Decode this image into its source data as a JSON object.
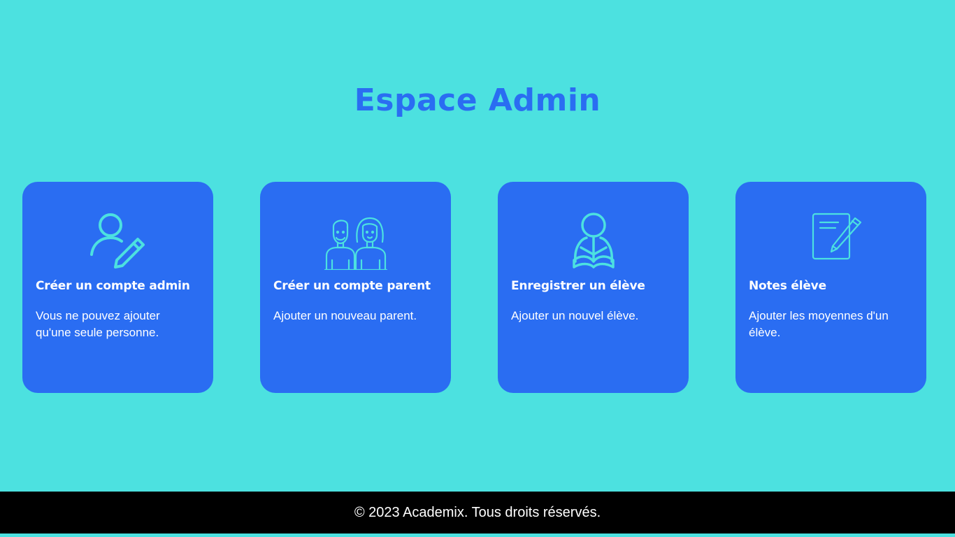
{
  "page_title": "Espace Admin",
  "colors": {
    "background": "#4ce1e0",
    "card": "#2a6df2",
    "title": "#2a6df2",
    "icon_stroke": "#4ce1e0",
    "footer": "#000000"
  },
  "cards": [
    {
      "icon": "user-edit-icon",
      "title": "Créer un compte admin",
      "description": "Vous ne pouvez ajouter qu'une seule personne."
    },
    {
      "icon": "parents-couple-icon",
      "title": "Créer un compte parent",
      "description": "Ajouter un nouveau parent."
    },
    {
      "icon": "student-reading-icon",
      "title": "Enregistrer un élève",
      "description": "Ajouter un nouvel élève."
    },
    {
      "icon": "notes-pencil-icon",
      "title": "Notes élève",
      "description": "Ajouter les moyennes d'un élève."
    }
  ],
  "footer": {
    "text": "© 2023 Academix. Tous droits réservés."
  }
}
